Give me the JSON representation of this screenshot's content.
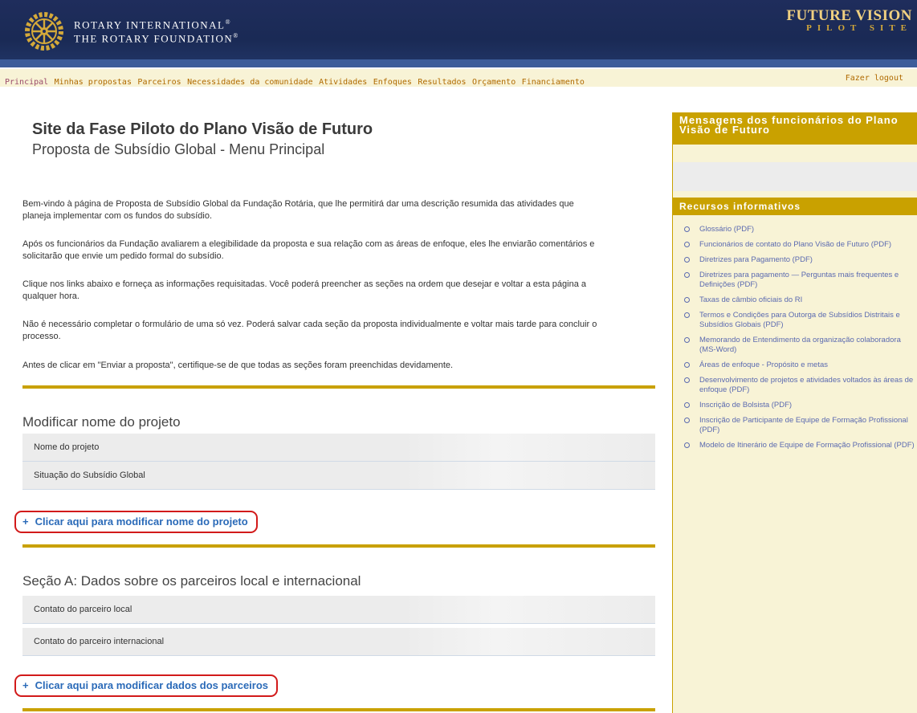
{
  "header": {
    "brand_line1": "ROTARY INTERNATIONAL",
    "brand_line2": "THE ROTARY FOUNDATION",
    "fv_line1": "FUTURE VISION",
    "fv_line2": "PILOT SITE",
    "logo_icon": "rotary-wheel-icon"
  },
  "nav": {
    "items": [
      "Principal",
      "Minhas propostas",
      "Parceiros",
      "Necessidades da comunidade",
      "Atividades",
      "Enfoques",
      "Resultados",
      "Orçamento",
      "Financiamento"
    ],
    "logout": "Fazer logout"
  },
  "main": {
    "title": "Site da Fase Piloto do Plano Visão de Futuro",
    "subtitle": "Proposta de Subsídio Global - Menu Principal",
    "paragraphs": [
      "Bem-vindo à página de Proposta de Subsídio Global da Fundação Rotária, que lhe permitirá dar uma descrição resumida das atividades que planeja implementar com os fundos do subsídio.",
      "Após os funcionários da Fundação avaliarem a elegibilidade da proposta e sua relação com as áreas de enfoque, eles lhe enviarão comentários e solicitarão que envie um pedido formal do subsídio.",
      "Clique nos links abaixo e forneça as informações requisitadas. Você poderá preencher as seções na ordem que desejar e voltar a esta página a qualquer hora.",
      "Não é necessário completar o formulário de uma só vez. Poderá salvar cada seção da proposta individualmente e voltar mais tarde para concluir o processo.",
      "Antes de clicar em \"Enviar a proposta\", certifique-se de que todas as seções foram preenchidas devidamente."
    ],
    "section1": {
      "title": "Modificar nome do projeto",
      "rows": [
        "Nome do projeto",
        "Situação do Subsídio Global"
      ],
      "cta": "Clicar aqui para modificar nome do projeto"
    },
    "section2": {
      "title": "Seção A: Dados sobre os parceiros local e internacional",
      "rows": [
        "Contato do parceiro local",
        "Contato do parceiro internacional"
      ],
      "cta": "Clicar aqui para modificar dados dos parceiros"
    },
    "plus": "+"
  },
  "sidebar": {
    "messages_title_1": "Mensagens dos funcionários do Plano",
    "messages_title_2": "Visão de Futuro",
    "resources_title": "Recursos informativos",
    "resources": [
      "Glossário (PDF)",
      "Funcionários de contato do Plano Visão de Futuro (PDF)",
      "Diretrizes para Pagamento (PDF)",
      "Diretrizes para pagamento — Perguntas mais frequentes e Definições (PDF)",
      "Taxas de câmbio oficiais do RI",
      "Termos e Condições para Outorga de Subsídios Distritais e Subsídios Globais (PDF)",
      "Memorando de Entendimento da organização colaboradora (MS-Word)",
      "Áreas de enfoque - Propósito e metas",
      "Desenvolvimento de projetos e atividades voltados às áreas de enfoque (PDF)",
      "Inscrição de Bolsista (PDF)",
      "Inscrição de Participante de Equipe de Formação Profissional (PDF)",
      "Modelo de Itinerário de Equipe de Formação Profissional (PDF)"
    ]
  },
  "colors": {
    "gold": "#c9a100",
    "navy": "#1f2d5c",
    "link": "#2a6ab8",
    "highlight": "#d21a1a"
  }
}
